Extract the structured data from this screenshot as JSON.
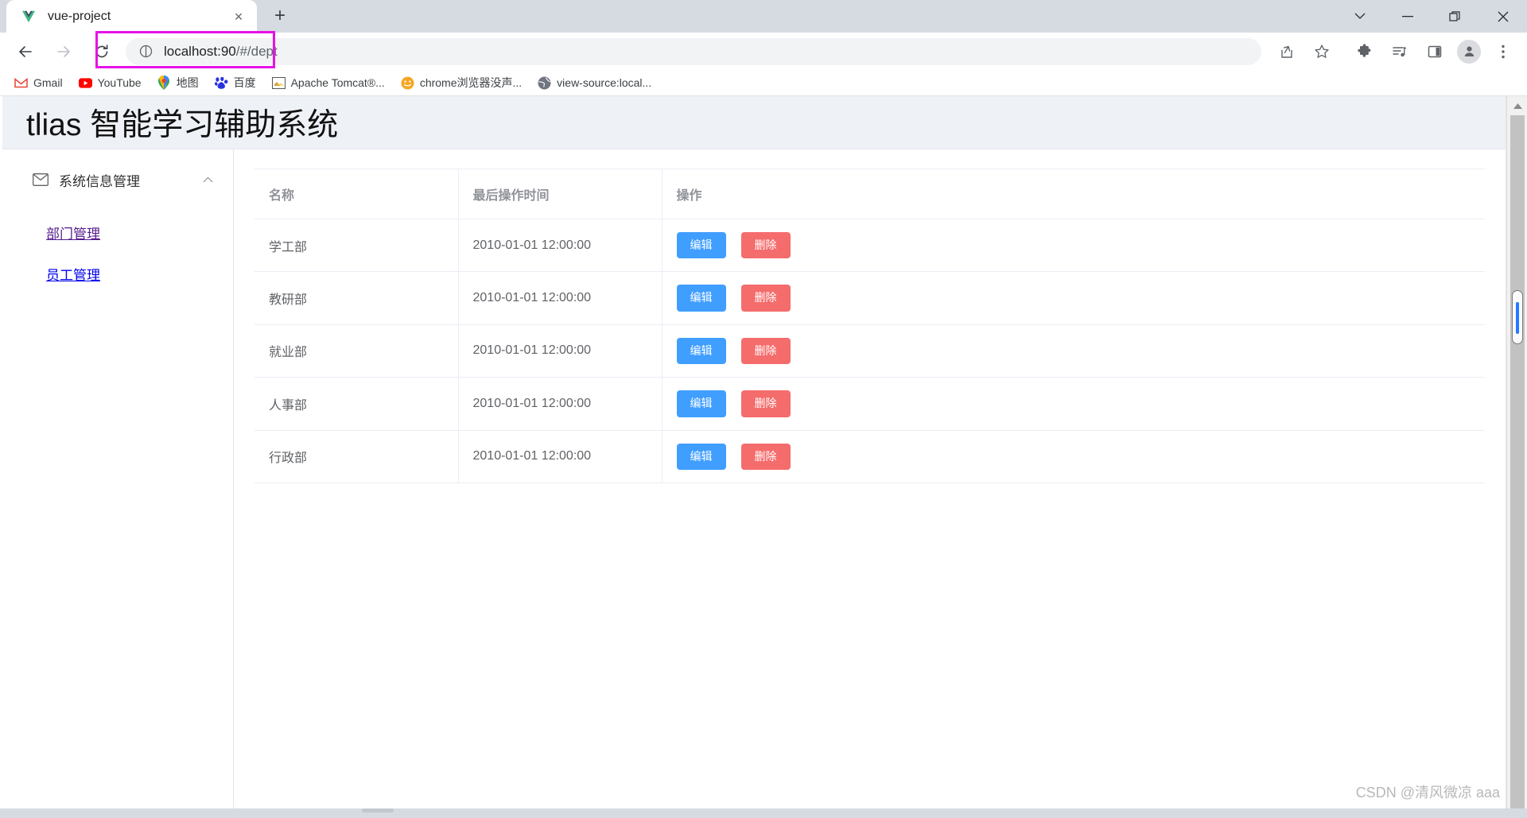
{
  "browser": {
    "tab": {
      "title": "vue-project",
      "favicon": "vue-logo-icon",
      "close_label": "×",
      "new_tab_label": "+"
    },
    "window_controls": [
      {
        "name": "tab-search-button",
        "glyph": "⌄"
      },
      {
        "name": "minimize-button",
        "glyph": "—"
      },
      {
        "name": "maximize-button",
        "glyph": "❐"
      },
      {
        "name": "close-window-button",
        "glyph": "✕"
      }
    ],
    "nav": {
      "back_label": "←",
      "forward_label": "→",
      "reload_label": "⟳"
    },
    "omnibox": {
      "site_icon": "info-circle-icon",
      "url_host": "localhost:90",
      "url_path": "/#/dept",
      "full_url": "localhost:90/#/dept",
      "highlight_color": "#e612e6"
    },
    "toolbar_icons": [
      {
        "name": "share-icon",
        "label": "Share"
      },
      {
        "name": "bookmark-star-icon",
        "label": "Bookmark"
      },
      {
        "name": "extensions-puzzle-icon",
        "label": "Extensions"
      },
      {
        "name": "reading-list-icon",
        "label": "Reading list"
      },
      {
        "name": "side-panel-icon",
        "label": "Side panel"
      },
      {
        "name": "profile-avatar-icon",
        "label": "Profile"
      },
      {
        "name": "chrome-menu-icon",
        "label": "Customize and control Google Chrome"
      }
    ],
    "bookmarks": [
      {
        "icon": "gmail-icon",
        "label": "Gmail"
      },
      {
        "icon": "youtube-icon",
        "label": "YouTube"
      },
      {
        "icon": "google-maps-icon",
        "label": "地图"
      },
      {
        "icon": "baidu-icon",
        "label": "百度"
      },
      {
        "icon": "tomcat-icon",
        "label": "Apache Tomcat®..."
      },
      {
        "icon": "generic-site-icon",
        "label": "chrome浏览器没声..."
      },
      {
        "icon": "globe-icon",
        "label": "view-source:local..."
      }
    ]
  },
  "app": {
    "title": "tlias 智能学习辅助系统",
    "sidebar": {
      "group": {
        "icon": "envelope-icon",
        "label": "系统信息管理",
        "arrow": "chevron-up-icon"
      },
      "items": [
        {
          "label": "部门管理",
          "state": "visited"
        },
        {
          "label": "员工管理",
          "state": "normal"
        }
      ]
    },
    "table": {
      "columns": [
        "名称",
        "最后操作时间",
        "操作"
      ],
      "actions": {
        "edit": "编辑",
        "delete": "删除",
        "edit_color": "#409eff",
        "delete_color": "#f56c6c"
      },
      "rows": [
        {
          "name": "学工部",
          "time": "2010-01-01 12:00:00"
        },
        {
          "name": "教研部",
          "time": "2010-01-01 12:00:00"
        },
        {
          "name": "就业部",
          "time": "2010-01-01 12:00:00"
        },
        {
          "name": "人事部",
          "time": "2010-01-01 12:00:00"
        },
        {
          "name": "行政部",
          "time": "2010-01-01 12:00:00"
        }
      ]
    }
  },
  "watermark": "CSDN @清风微凉 aaa"
}
